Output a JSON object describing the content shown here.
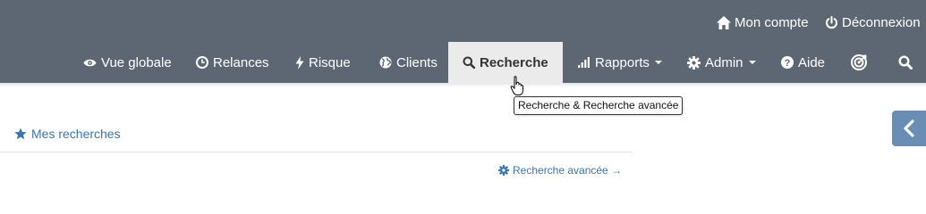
{
  "colors": {
    "topbar": "#5d6773",
    "active_tab_bg": "#ebebeb",
    "link": "#3a74ad",
    "side_toggle": "#6a8db5"
  },
  "utility": {
    "account": {
      "icon": "home-icon",
      "label": "Mon compte"
    },
    "logout": {
      "icon": "power-icon",
      "label": "Déconnexion"
    }
  },
  "nav": {
    "items": [
      {
        "icon": "eye-icon",
        "label": "Vue globale"
      },
      {
        "icon": "clock-icon",
        "label": "Relances"
      },
      {
        "icon": "bolt-icon",
        "label": "Risque"
      },
      {
        "icon": "globe-icon",
        "label": "Clients"
      },
      {
        "icon": "search-icon",
        "label": "Recherche",
        "active": true
      },
      {
        "icon": "bar-chart-icon",
        "label": "Rapports",
        "dropdown": true
      },
      {
        "icon": "gear-icon",
        "label": "Admin",
        "dropdown": true
      },
      {
        "icon": "question-circle-icon",
        "label": "Aide"
      },
      {
        "icon": "target-icon",
        "label": ""
      },
      {
        "icon": "search-icon",
        "label": ""
      }
    ]
  },
  "tooltip": {
    "text": "Recherche & Recherche avancée"
  },
  "content": {
    "saved_searches": {
      "icon": "star-icon",
      "label": "Mes recherches"
    },
    "advanced_search": {
      "icon": "gear-icon",
      "label": "Recherche avancée →"
    }
  },
  "side_toggle": {
    "icon": "chevron-left-icon"
  }
}
